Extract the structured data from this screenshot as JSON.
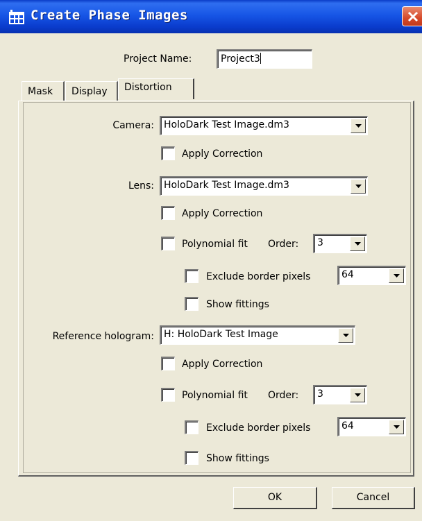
{
  "window": {
    "title": "Create Phase Images",
    "close_icon": "close-icon",
    "app_icon": "dialog-app-icon"
  },
  "project": {
    "label": "Project Name:",
    "value": "Project3"
  },
  "tabs": [
    {
      "label": "Mask",
      "active": false
    },
    {
      "label": "Display",
      "active": false
    },
    {
      "label": "Distortion",
      "active": true
    }
  ],
  "camera": {
    "label": "Camera:",
    "selected": "HoloDark Test Image.dm3",
    "apply_correction": {
      "label": "Apply Correction",
      "checked": false
    }
  },
  "lens": {
    "label": "Lens:",
    "selected": "HoloDark Test Image.dm3",
    "apply_correction": {
      "label": "Apply Correction",
      "checked": false
    },
    "polynomial_fit": {
      "label": "Polynomial fit",
      "checked": false
    },
    "order": {
      "label": "Order:",
      "selected": "3"
    },
    "exclude_border": {
      "label": "Exclude border pixels",
      "checked": false,
      "selected": "64"
    },
    "show_fittings": {
      "label": "Show fittings",
      "checked": false
    }
  },
  "reference": {
    "label": "Reference hologram:",
    "selected": "H: HoloDark Test Image",
    "apply_correction": {
      "label": "Apply Correction",
      "checked": false
    },
    "polynomial_fit": {
      "label": "Polynomial fit",
      "checked": false
    },
    "order": {
      "label": "Order:",
      "selected": "3"
    },
    "exclude_border": {
      "label": "Exclude border pixels",
      "checked": false,
      "selected": "64"
    },
    "show_fittings": {
      "label": "Show fittings",
      "checked": false
    }
  },
  "buttons": {
    "ok": "OK",
    "cancel": "Cancel"
  },
  "colors": {
    "titlebar": "#0a3dc8",
    "close": "#d6492a",
    "dialog": "#ece9d8"
  }
}
